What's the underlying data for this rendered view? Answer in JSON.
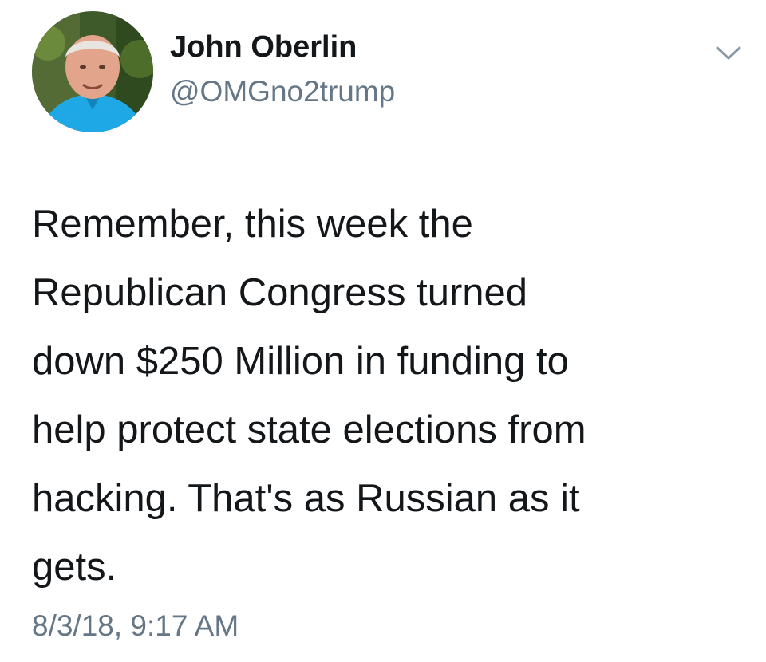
{
  "author": {
    "display_name": "John Oberlin",
    "handle": "@OMGno2trump",
    "avatar_icon": "profile-photo"
  },
  "tweet": {
    "text": "Remember, this week the\nRepublican Congress turned\ndown $250 Million in funding to\nhelp protect state elections from\nhacking.  That's as Russian as it\ngets.",
    "timestamp": "8/3/18, 9:17 AM"
  },
  "menu": {
    "icon": "chevron-down-icon"
  },
  "colors": {
    "text_primary": "#14171a",
    "text_secondary": "#657786",
    "background": "#ffffff"
  }
}
